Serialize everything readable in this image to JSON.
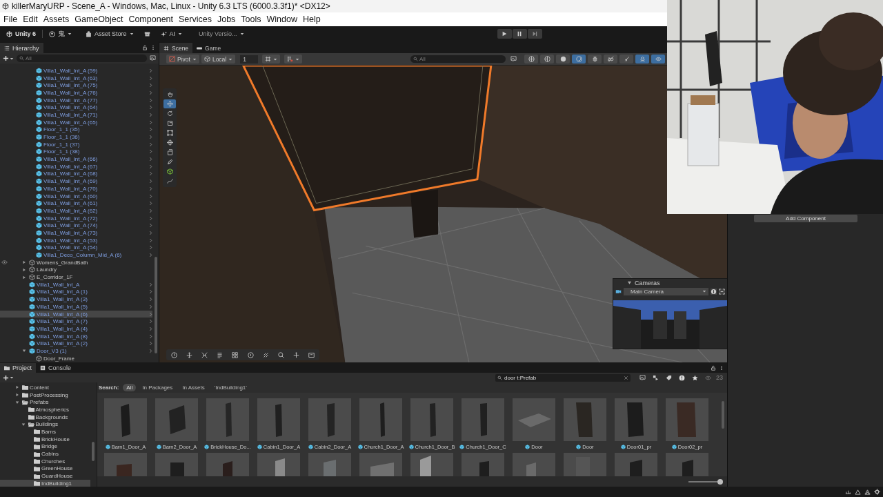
{
  "window": {
    "title": "killerMaryURP - Scene_A - Windows, Mac, Linux - Unity 6.3 LTS (6000.3.3f1)* <DX12>"
  },
  "menu": [
    "File",
    "Edit",
    "Assets",
    "GameObject",
    "Component",
    "Services",
    "Jobs",
    "Tools",
    "Window",
    "Help"
  ],
  "toolbar": {
    "product": "Unity 6",
    "account": "鬼",
    "asset_store": "Asset Store",
    "ai": "AI",
    "version_control": "Unity Versio..."
  },
  "hierarchy": {
    "tab": "Hierarchy",
    "search": {
      "placeholder": "All"
    },
    "partial_branch": [
      {
        "name": "Villa1_Wall_Int_A (59)",
        "kind": "prefab",
        "selected": false
      },
      {
        "name": "Villa1_Wall_Int_A (63)",
        "kind": "prefab",
        "selected": false
      },
      {
        "name": "Villa1_Wall_Int_A (75)",
        "kind": "prefab",
        "selected": false
      },
      {
        "name": "Villa1_Wall_Int_A (76)",
        "kind": "prefab",
        "selected": false
      },
      {
        "name": "Villa1_Wall_Int_A (77)",
        "kind": "prefab",
        "selected": false
      },
      {
        "name": "Villa1_Wall_Int_A (64)",
        "kind": "prefab",
        "selected": false
      },
      {
        "name": "Villa1_Wall_Int_A (71)",
        "kind": "prefab",
        "selected": false
      },
      {
        "name": "Villa1_Wall_Int_A (65)",
        "kind": "prefab",
        "selected": false
      },
      {
        "name": "Floor_1_1 (35)",
        "kind": "prefab",
        "selected": false
      },
      {
        "name": "Floor_1_1 (36)",
        "kind": "prefab",
        "selected": false
      },
      {
        "name": "Floor_1_1 (37)",
        "kind": "prefab",
        "selected": false
      },
      {
        "name": "Floor_1_1 (38)",
        "kind": "prefab",
        "selected": false
      },
      {
        "name": "Villa1_Wall_Int_A (66)",
        "kind": "prefab",
        "selected": false
      },
      {
        "name": "Villa1_Wall_Int_A (67)",
        "kind": "prefab",
        "selected": false
      },
      {
        "name": "Villa1_Wall_Int_A (68)",
        "kind": "prefab",
        "selected": false
      },
      {
        "name": "Villa1_Wall_Int_A (69)",
        "kind": "prefab",
        "selected": false
      },
      {
        "name": "Villa1_Wall_Int_A (70)",
        "kind": "prefab",
        "selected": false
      },
      {
        "name": "Villa1_Wall_Int_A (60)",
        "kind": "prefab",
        "selected": false
      },
      {
        "name": "Villa1_Wall_Int_A (61)",
        "kind": "prefab",
        "selected": false
      },
      {
        "name": "Villa1_Wall_Int_A (62)",
        "kind": "prefab",
        "selected": false
      },
      {
        "name": "Villa1_Wall_Int_A (72)",
        "kind": "prefab",
        "selected": false
      },
      {
        "name": "Villa1_Wall_Int_A (74)",
        "kind": "prefab",
        "selected": false
      },
      {
        "name": "Villa1_Wall_Int_A (73)",
        "kind": "prefab",
        "selected": false
      },
      {
        "name": "Villa1_Wall_Int_A (53)",
        "kind": "prefab",
        "selected": false
      },
      {
        "name": "Villa1_Wall_Int_A (54)",
        "kind": "prefab",
        "selected": false
      },
      {
        "name": "Villa1_Deco_Column_Mid_A (6)",
        "kind": "prefab",
        "selected": false
      }
    ],
    "items": [
      {
        "name": "Womens_GrandBath",
        "kind": "object",
        "expanded": false,
        "hovered": true,
        "selected": false
      },
      {
        "name": "Laundry",
        "kind": "object",
        "expanded": false,
        "hovered": false,
        "selected": false
      },
      {
        "name": "E_Corridor_1F",
        "kind": "object",
        "expanded": false,
        "hovered": false,
        "selected": false
      },
      {
        "name": "Villa1_Wall_Int_A",
        "kind": "prefab",
        "hovered": false,
        "selected": false
      },
      {
        "name": "Villa1_Wall_Int_A (1)",
        "kind": "prefab",
        "hovered": false,
        "selected": false
      },
      {
        "name": "Villa1_Wall_Int_A (3)",
        "kind": "prefab",
        "hovered": false,
        "selected": false
      },
      {
        "name": "Villa1_Wall_Int_A (5)",
        "kind": "prefab",
        "hovered": false,
        "selected": false
      },
      {
        "name": "Villa1_Wall_Int_A (6)",
        "kind": "prefab",
        "hovered": false,
        "selected": true
      },
      {
        "name": "Villa1_Wall_Int_A (7)",
        "kind": "prefab",
        "hovered": false,
        "selected": false
      },
      {
        "name": "Villa1_Wall_Int_A (4)",
        "kind": "prefab",
        "hovered": false,
        "selected": false
      },
      {
        "name": "Villa1_Wall_Int_A (8)",
        "kind": "prefab",
        "hovered": false,
        "selected": false
      },
      {
        "name": "Villa1_Wall_Int_A (2)",
        "kind": "prefab",
        "hovered": false,
        "selected": false
      },
      {
        "name": "Door_V3 (1)",
        "kind": "prefab",
        "expanded": true,
        "hovered": false,
        "selected": false,
        "children": [
          {
            "name": "Door_Frame",
            "kind": "object",
            "selected": false
          }
        ]
      }
    ]
  },
  "scene": {
    "tabs": [
      {
        "label": "Scene",
        "selected": true
      },
      {
        "label": "Game",
        "selected": false
      }
    ],
    "pivot": "Pivot",
    "space": "Local",
    "grid_size": "1",
    "search": {
      "placeholder": "All"
    },
    "view_toggles": [
      {
        "kind": "globe",
        "selected": false
      },
      {
        "kind": "half-globe",
        "selected": false
      },
      {
        "kind": "sphere",
        "selected": false
      },
      {
        "kind": "ring",
        "selected": true
      },
      {
        "kind": "bug",
        "selected": false
      },
      {
        "kind": "flat",
        "selected": false
      },
      {
        "kind": "audio",
        "selected": false
      },
      {
        "kind": "gizmo",
        "selected": true
      },
      {
        "kind": "eye",
        "selected": true
      }
    ],
    "tools": [
      {
        "kind": "hand",
        "selected": false
      },
      {
        "kind": "move",
        "selected": true
      },
      {
        "kind": "rotate",
        "selected": false
      },
      {
        "kind": "scale",
        "selected": false
      },
      {
        "kind": "rect",
        "selected": false
      },
      {
        "kind": "transform",
        "selected": false
      },
      {
        "kind": "custom",
        "selected": false
      },
      {
        "kind": "probuilder",
        "selected": false
      },
      {
        "kind": "cube",
        "selected": false
      },
      {
        "kind": "spline",
        "selected": false
      }
    ],
    "cameras_overlay": {
      "title": "Cameras",
      "camera": "Main Camera"
    }
  },
  "inspector": {
    "add_component": "Add Component"
  },
  "project": {
    "tabs": [
      {
        "label": "Project",
        "selected": true
      },
      {
        "label": "Console",
        "selected": false
      }
    ],
    "folders": [
      {
        "name": "Content",
        "expanded": false,
        "selected": false
      },
      {
        "name": "PostProcessing",
        "expanded": false,
        "selected": false
      },
      {
        "name": "Prefabs",
        "expanded": true,
        "selected": false,
        "children": [
          {
            "name": "Atmospherics",
            "selected": false
          },
          {
            "name": "Backgrounds",
            "selected": false
          },
          {
            "name": "Buildings",
            "expanded": true,
            "selected": false,
            "children": [
              {
                "name": "Barns",
                "selected": false
              },
              {
                "name": "BrickHouse",
                "selected": false
              },
              {
                "name": "Bridge",
                "selected": false
              },
              {
                "name": "Cabins",
                "selected": false
              },
              {
                "name": "Churches",
                "selected": false
              },
              {
                "name": "GreenHouse",
                "selected": false
              },
              {
                "name": "GuardHouse",
                "selected": false
              },
              {
                "name": "IndBuilding1",
                "selected": true
              }
            ]
          }
        ]
      }
    ],
    "search_label": "Search:",
    "search_scopes": [
      {
        "label": "All",
        "selected": true
      },
      {
        "label": "In Packages",
        "selected": false
      },
      {
        "label": "In Assets",
        "selected": false
      },
      {
        "label": "'IndBuilding1'",
        "selected": false
      }
    ],
    "search": {
      "value": "door t:Prefab"
    },
    "result_count": "23",
    "assets": [
      {
        "label": "Barn1_Door_A"
      },
      {
        "label": "Barn2_Door_A"
      },
      {
        "label": "BrickHouse_Do..."
      },
      {
        "label": "Cabin1_Door_A"
      },
      {
        "label": "Cabin2_Door_A"
      },
      {
        "label": "Church1_Door_A"
      },
      {
        "label": "Church1_Door_B"
      },
      {
        "label": "Church1_Door_C"
      },
      {
        "label": "Door"
      },
      {
        "label": "Door"
      },
      {
        "label": "Door01_pr"
      },
      {
        "label": "Door02_pr"
      }
    ],
    "zoom_slider": {
      "level": 1
    }
  }
}
